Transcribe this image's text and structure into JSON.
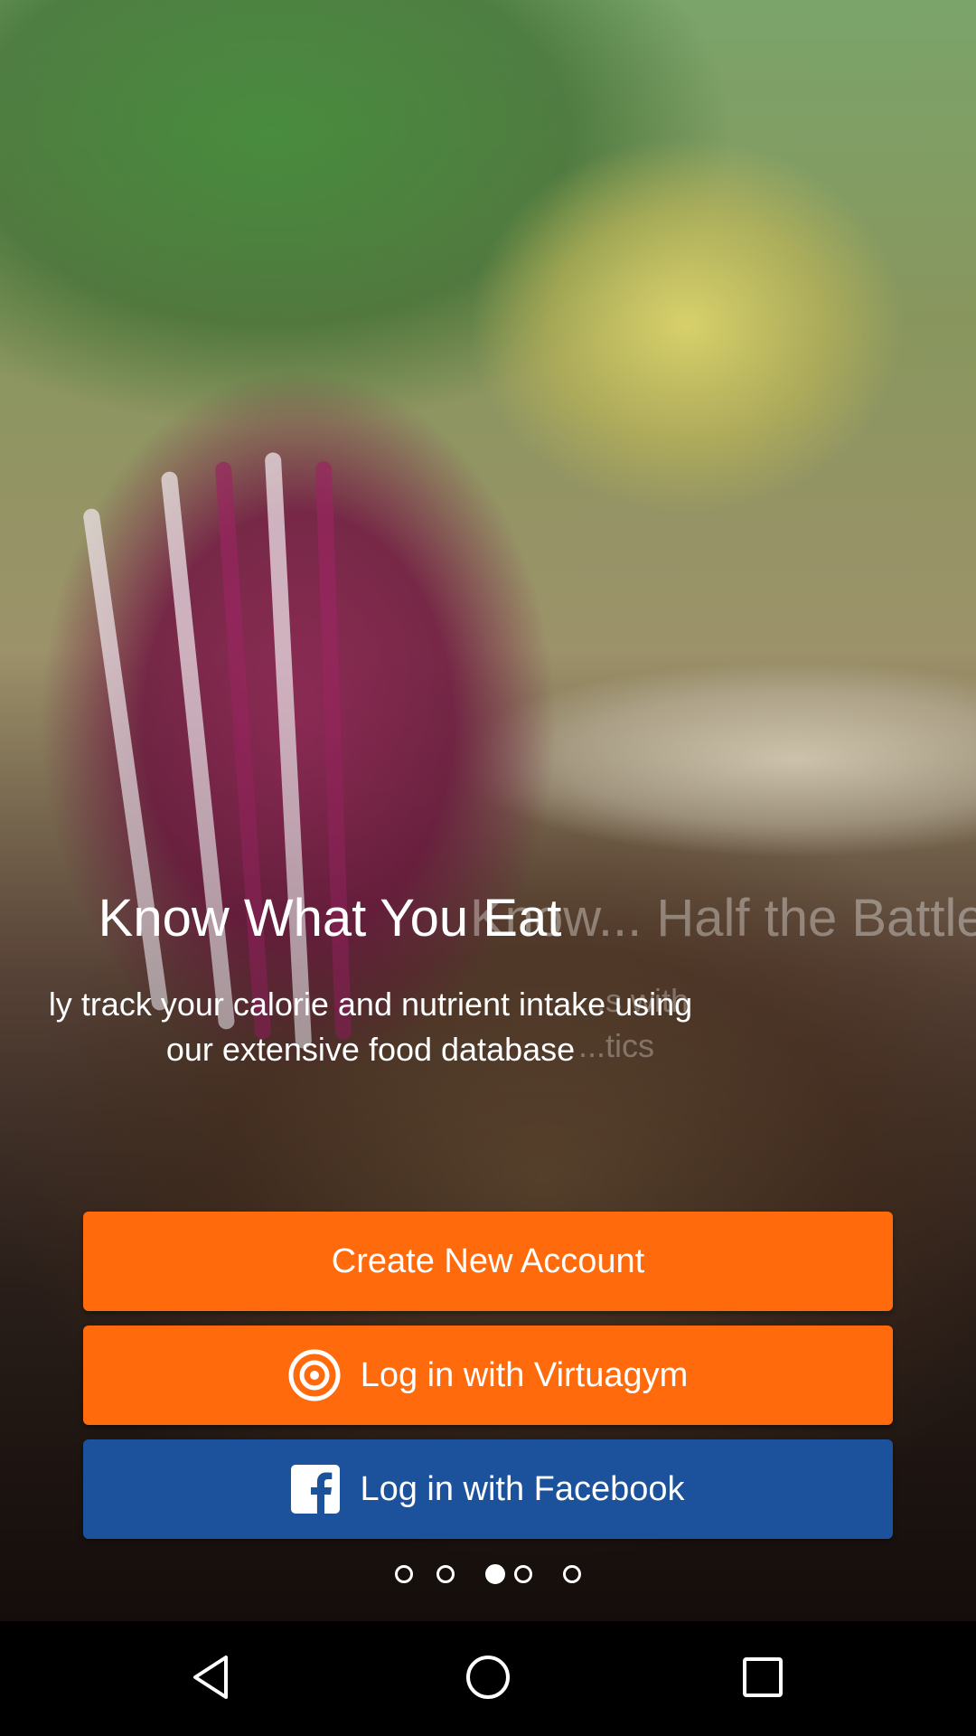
{
  "onboarding": {
    "title": "Know What You Eat",
    "subtitle_line1": "ly track your calorie and nutrient intake using",
    "subtitle_line2": "our extensive food database",
    "next_slide_title": "Know... Half the Battle",
    "next_slide_sub1": "...s with",
    "next_slide_sub2": "...tics"
  },
  "buttons": {
    "create_account": "Create New Account",
    "login_virtuagym": "Log in with Virtuagym",
    "login_facebook": "Log in with Facebook"
  },
  "pager": {
    "count": 5,
    "active_index": 2
  },
  "colors": {
    "orange": "#ff6a0c",
    "facebook_blue": "#1c519b",
    "navbar": "#000000"
  },
  "icons": {
    "virtuagym": "virtuagym-logo-icon",
    "facebook": "facebook-icon",
    "back": "back-icon",
    "home": "home-icon",
    "recents": "recents-icon"
  }
}
